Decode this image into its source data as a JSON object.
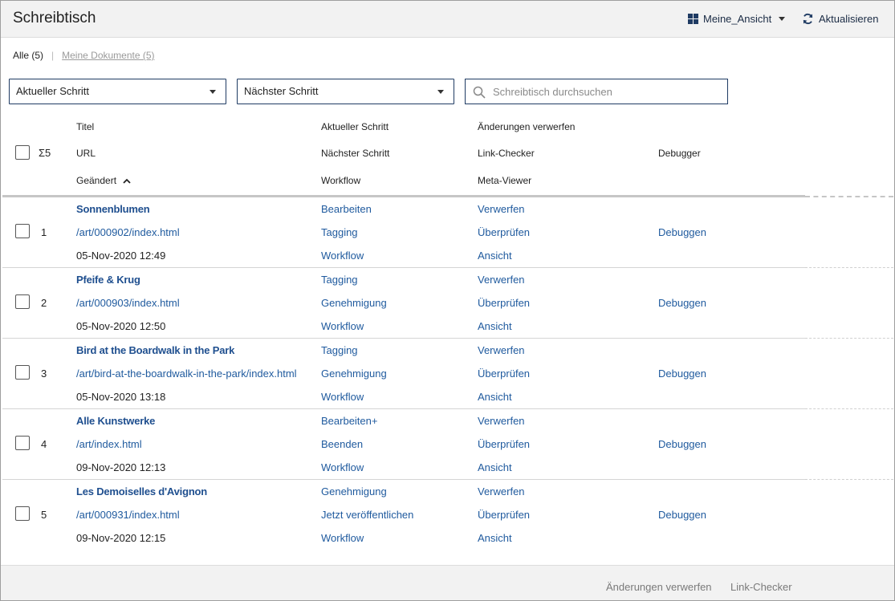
{
  "header": {
    "title": "Schreibtisch",
    "view_label": "Meine_Ansicht",
    "refresh_label": "Aktualisieren"
  },
  "tabs": {
    "all_label": "Alle (5)",
    "mine_label": "Meine Dokumente (5)"
  },
  "filters": {
    "current_step": "Aktueller Schritt",
    "next_step": "Nächster Schritt",
    "search_placeholder": "Schreibtisch durchsuchen"
  },
  "columns": {
    "sum": "Σ5",
    "title": "Titel",
    "url": "URL",
    "changed": "Geändert",
    "current_step": "Aktueller Schritt",
    "next_step": "Nächster Schritt",
    "workflow": "Workflow",
    "discard": "Änderungen verwerfen",
    "link_checker": "Link-Checker",
    "meta_viewer": "Meta-Viewer",
    "debugger": "Debugger"
  },
  "rows": [
    {
      "num": "1",
      "title": "Sonnenblumen",
      "url": "/art/000902/index.html",
      "date": "05-Nov-2020 12:49",
      "current": "Bearbeiten",
      "next": "Tagging",
      "workflow": "Workflow",
      "discard": "Verwerfen",
      "check": "Überprüfen",
      "view": "Ansicht",
      "debug": "Debuggen"
    },
    {
      "num": "2",
      "title": "Pfeife & Krug",
      "url": "/art/000903/index.html",
      "date": "05-Nov-2020 12:50",
      "current": "Tagging",
      "next": "Genehmigung",
      "workflow": "Workflow",
      "discard": "Verwerfen",
      "check": "Überprüfen",
      "view": "Ansicht",
      "debug": "Debuggen"
    },
    {
      "num": "3",
      "title": "Bird at the Boardwalk in the Park",
      "url": "/art/bird-at-the-boardwalk-in-the-park/index.html",
      "date": "05-Nov-2020 13:18",
      "current": "Tagging",
      "next": "Genehmigung",
      "workflow": "Workflow",
      "discard": "Verwerfen",
      "check": "Überprüfen",
      "view": "Ansicht",
      "debug": "Debuggen"
    },
    {
      "num": "4",
      "title": "Alle Kunstwerke",
      "url": "/art/index.html",
      "date": "09-Nov-2020 12:13",
      "current": "Bearbeiten+",
      "next": "Beenden",
      "workflow": "Workflow",
      "discard": "Verwerfen",
      "check": "Überprüfen",
      "view": "Ansicht",
      "debug": "Debuggen"
    },
    {
      "num": "5",
      "title": "Les Demoiselles d'Avignon",
      "url": "/art/000931/index.html",
      "date": "09-Nov-2020 12:15",
      "current": "Genehmigung",
      "next": "Jetzt veröffentlichen",
      "workflow": "Workflow",
      "discard": "Verwerfen",
      "check": "Überprüfen",
      "view": "Ansicht",
      "debug": "Debuggen"
    }
  ],
  "footer": {
    "discard_label": "Änderungen verwerfen",
    "link_checker_label": "Link-Checker"
  }
}
